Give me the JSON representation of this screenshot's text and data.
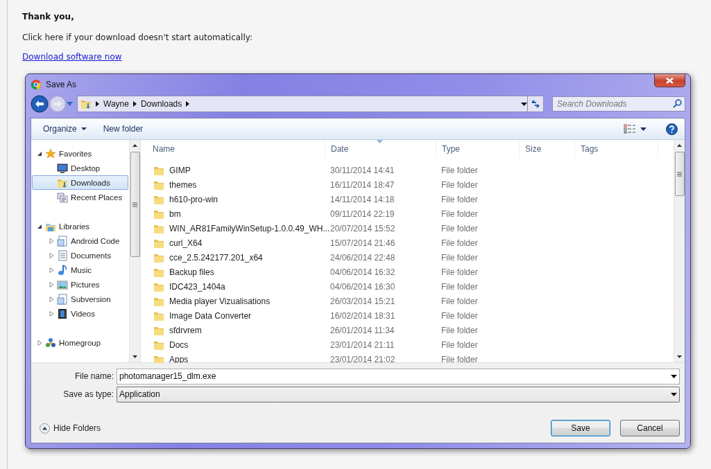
{
  "page": {
    "heading": "Thank you,",
    "instruction": "Click here if your download doesn't start automatically:",
    "link": "Download software now"
  },
  "dialog": {
    "title": "Save As",
    "breadcrumb": [
      "Wayne",
      "Downloads"
    ],
    "search": {
      "placeholder": "Search Downloads"
    },
    "toolbar": [
      {
        "label": "Organize",
        "dropdown": true
      },
      {
        "label": "New folder",
        "dropdown": false
      }
    ],
    "nav": [
      {
        "label": "Favorites",
        "kind": "favorites",
        "expanded": true,
        "selected": false,
        "children": [
          {
            "label": "Desktop",
            "kind": "desktop",
            "selected": false
          },
          {
            "label": "Downloads",
            "kind": "downloads",
            "selected": true
          },
          {
            "label": "Recent Places",
            "kind": "recent",
            "selected": false
          }
        ]
      },
      {
        "label": "Libraries",
        "kind": "libraries",
        "expanded": true,
        "selected": false,
        "children": [
          {
            "label": "Android Code",
            "kind": "library",
            "expanded": false,
            "selected": false
          },
          {
            "label": "Documents",
            "kind": "documents",
            "expanded": false,
            "selected": false
          },
          {
            "label": "Music",
            "kind": "music",
            "expanded": false,
            "selected": false
          },
          {
            "label": "Pictures",
            "kind": "pictures",
            "expanded": false,
            "selected": false
          },
          {
            "label": "Subversion",
            "kind": "library",
            "expanded": false,
            "selected": false
          },
          {
            "label": "Videos",
            "kind": "videos",
            "expanded": false,
            "selected": false
          }
        ]
      },
      {
        "label": "Homegroup",
        "kind": "homegroup",
        "expanded": false,
        "selected": false
      }
    ],
    "columns": [
      {
        "label": "Name",
        "sorted": false
      },
      {
        "label": "Date",
        "sorted": true
      },
      {
        "label": "Type",
        "sorted": false
      },
      {
        "label": "Size",
        "sorted": false
      },
      {
        "label": "Tags",
        "sorted": false
      }
    ],
    "rows": [
      {
        "name": "GIMP",
        "date": "30/11/2014 14:41",
        "type": "File folder"
      },
      {
        "name": "themes",
        "date": "16/11/2014 18:47",
        "type": "File folder"
      },
      {
        "name": "h610-pro-win",
        "date": "14/11/2014 14:18",
        "type": "File folder"
      },
      {
        "name": "bm",
        "date": "09/11/2014 22:19",
        "type": "File folder"
      },
      {
        "name": "WIN_AR81FamilyWinSetup-1.0.0.49_WH...",
        "date": "20/07/2014 15:52",
        "type": "File folder"
      },
      {
        "name": "curl_X64",
        "date": "15/07/2014 21:46",
        "type": "File folder"
      },
      {
        "name": "cce_2.5.242177.201_x64",
        "date": "24/06/2014 22:48",
        "type": "File folder"
      },
      {
        "name": "Backup files",
        "date": "04/06/2014 16:32",
        "type": "File folder"
      },
      {
        "name": "IDC423_1404a",
        "date": "04/06/2014 16:30",
        "type": "File folder"
      },
      {
        "name": "Media player Vizualisations",
        "date": "26/03/2014 15:21",
        "type": "File folder"
      },
      {
        "name": "Image Data Converter",
        "date": "16/02/2014 18:31",
        "type": "File folder"
      },
      {
        "name": "sfdrvrem",
        "date": "26/01/2014 11:34",
        "type": "File folder"
      },
      {
        "name": "Docs",
        "date": "23/01/2014 21:11",
        "type": "File folder"
      },
      {
        "name": "Apps",
        "date": "23/01/2014 21:02",
        "type": "File folder"
      }
    ],
    "file_name": {
      "label": "File name:",
      "value": "photomanager15_dlm.exe"
    },
    "save_type": {
      "label": "Save as type:",
      "value": "Application"
    },
    "hide_folders": "Hide Folders",
    "buttons": [
      {
        "label": "Save",
        "default": true
      },
      {
        "label": "Cancel",
        "default": false
      }
    ]
  }
}
